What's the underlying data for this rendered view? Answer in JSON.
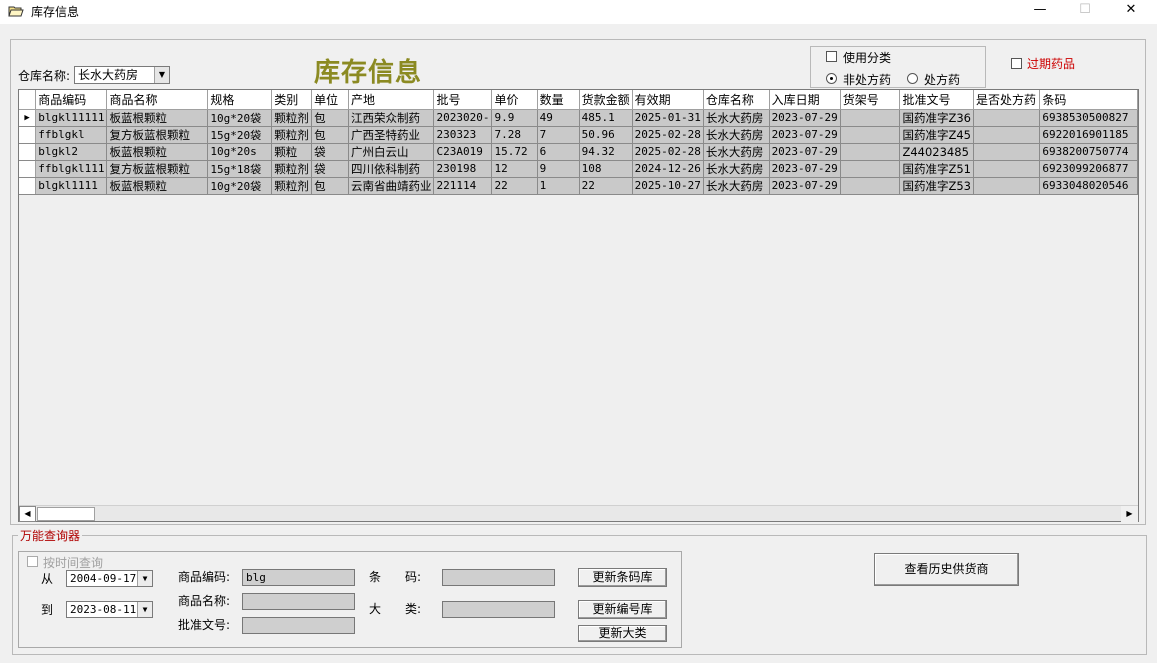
{
  "window": {
    "title": "库存信息",
    "minimize": "—",
    "maximize": "☐",
    "close": "✕"
  },
  "warehouse": {
    "label": "仓库名称:",
    "value": "长水大药房"
  },
  "page_title": "库存信息",
  "options": {
    "use_category": "使用分类",
    "non_prescription": "非处方药",
    "prescription": "处方药",
    "selected": "non_prescription"
  },
  "expired": {
    "label": "过期药品",
    "color": "#cc0000"
  },
  "grid": {
    "columns": [
      "商品编码",
      "商品名称",
      "规格",
      "类别",
      "单位",
      "产地",
      "批号",
      "单价",
      "数量",
      "货款金额",
      "有效期",
      "仓库名称",
      "入库日期",
      "货架号",
      "批准文号",
      "是否处方药",
      "条码"
    ],
    "rows": [
      [
        "blgkl11111",
        "板蓝根颗粒",
        "10g*20袋",
        "颗粒剂",
        "包",
        "江西荣众制药",
        "2023020-",
        "9.9",
        "49",
        "485.1",
        "2025-01-31",
        "长水大药房",
        "2023-07-29",
        "",
        "国药准字Z36",
        "",
        "6938530500827"
      ],
      [
        "ffblgkl",
        "复方板蓝根颗粒",
        "15g*20袋",
        "颗粒剂",
        "包",
        "广西圣特药业",
        "230323",
        "7.28",
        "7",
        "50.96",
        "2025-02-28",
        "长水大药房",
        "2023-07-29",
        "",
        "国药准字Z45",
        "",
        "6922016901185"
      ],
      [
        "blgkl2",
        "板蓝根颗粒",
        "10g*20s",
        "颗粒",
        "袋",
        "广州白云山",
        "C23A019",
        "15.72",
        "6",
        "94.32",
        "2025-02-28",
        "长水大药房",
        "2023-07-29",
        "",
        "Z44023485",
        "",
        "6938200750774"
      ],
      [
        "ffblgkl111",
        "复方板蓝根颗粒",
        "15g*18袋",
        "颗粒剂",
        "袋",
        "四川依科制药",
        "230198",
        "12",
        "9",
        "108",
        "2024-12-26",
        "长水大药房",
        "2023-07-29",
        "",
        "国药准字Z51",
        "",
        "6923099206877"
      ],
      [
        "blgkl1111",
        "板蓝根颗粒",
        "10g*20袋",
        "颗粒剂",
        "包",
        "云南省曲靖药业",
        "221114",
        "22",
        "1",
        "22",
        "2025-10-27",
        "长水大药房",
        "2023-07-29",
        "",
        "国药准字Z53",
        "",
        "6933048020546"
      ]
    ],
    "current_row_marker": "▶"
  },
  "query": {
    "group_label": "万能查询器",
    "by_time": "按时间查询",
    "from_label": "从",
    "to_label": "到",
    "from_date": "2004-09-17",
    "to_date": "2023-08-11",
    "code_label": "商品编码:",
    "code_value": "blg",
    "name_label": "商品名称:",
    "name_value": "",
    "approval_label": "批准文号:",
    "approval_value": "",
    "barcode_label": "条　　码:",
    "barcode_value": "",
    "category_label": "大　　类:",
    "category_value": "",
    "btn_update_barcode": "更新条码库",
    "btn_update_code": "更新编号库",
    "btn_update_category": "更新大类",
    "btn_history_supplier": "查看历史供货商"
  }
}
